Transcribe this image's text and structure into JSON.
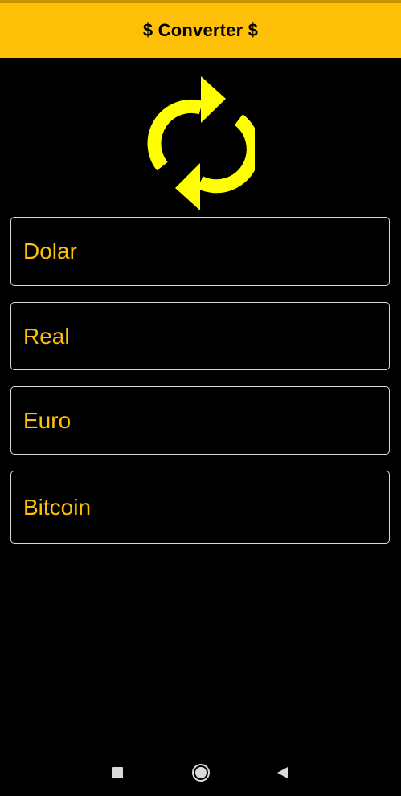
{
  "app_bar": {
    "title": "$ Converter $",
    "background": "#ffc107"
  },
  "refresh_button": {
    "icon": "refresh-icon",
    "color": "#ffff00"
  },
  "fields": [
    {
      "label": "Dolar"
    },
    {
      "label": "Real"
    },
    {
      "label": "Euro"
    },
    {
      "label": "Bitcoin"
    }
  ],
  "nav_bar": {
    "recents_icon": "square-icon",
    "home_icon": "circle-icon",
    "back_icon": "triangle-back-icon"
  },
  "colors": {
    "accent": "#ffc107",
    "background": "#000000",
    "field_border": "#d8d8d8"
  }
}
